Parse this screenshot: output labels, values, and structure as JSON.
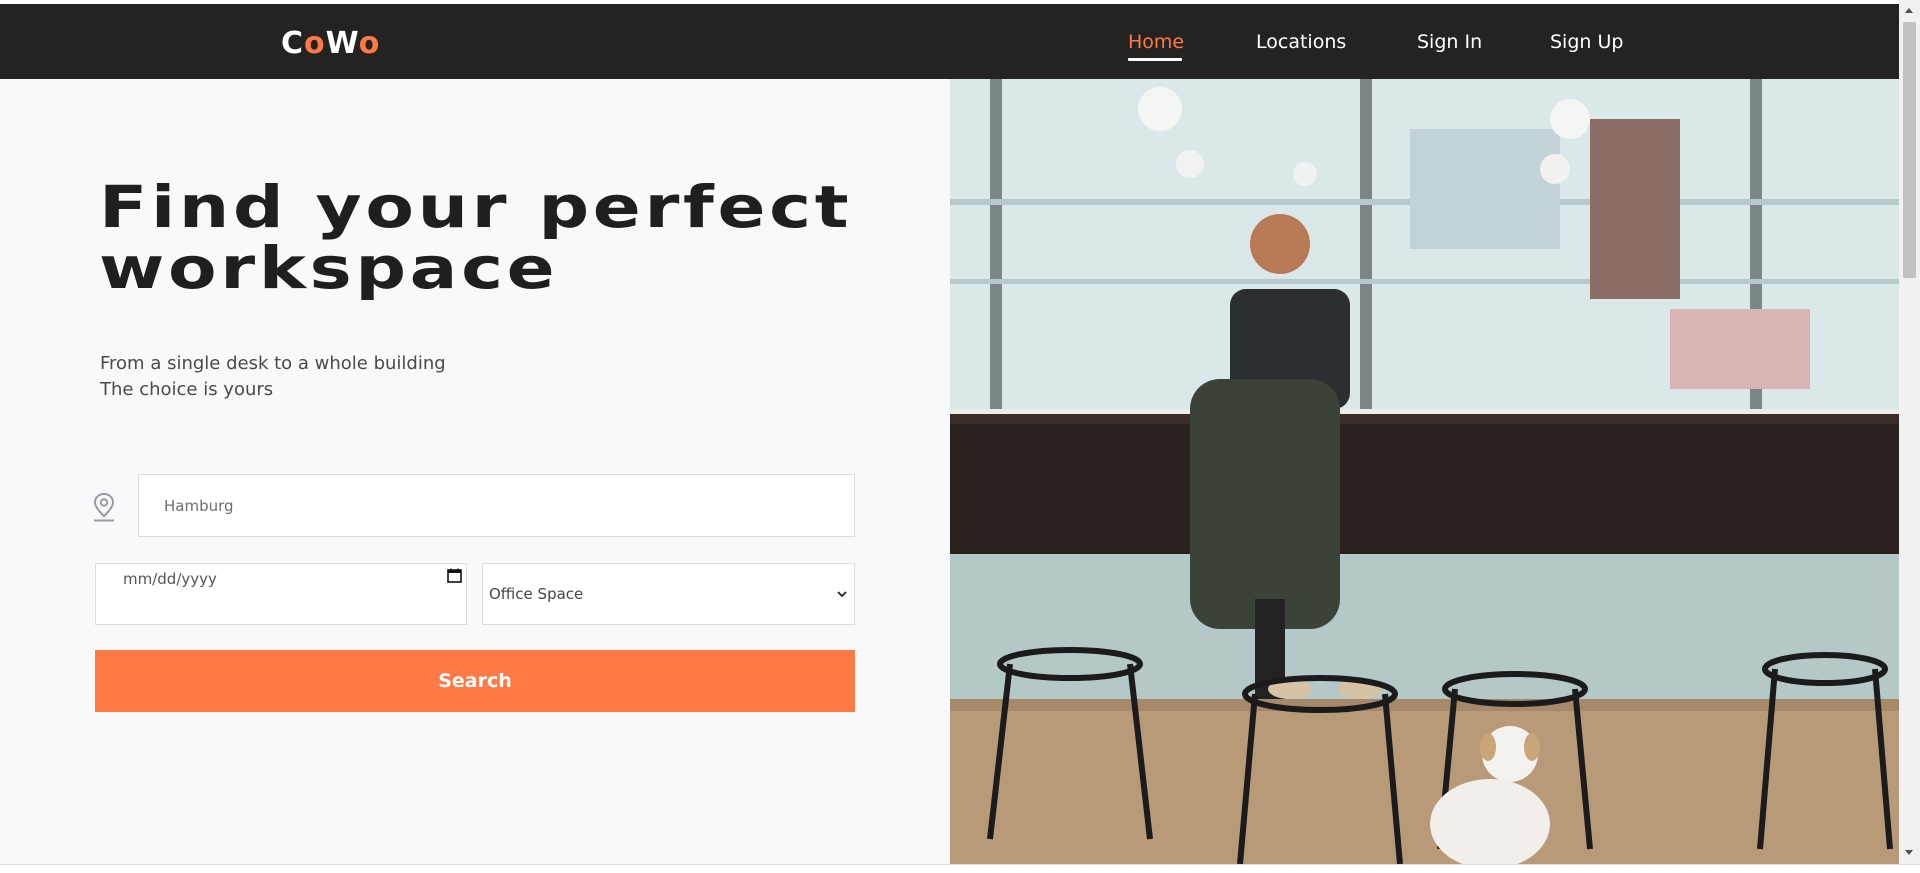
{
  "brand": {
    "logo_letters": [
      "C",
      "o",
      "W",
      "o"
    ],
    "accent_color": "#ff7a45",
    "nav_bg": "#252321"
  },
  "nav": {
    "items": [
      {
        "label": "Home",
        "active": true
      },
      {
        "label": "Locations",
        "active": false
      },
      {
        "label": "Sign In",
        "active": false
      },
      {
        "label": "Sign Up",
        "active": false
      }
    ]
  },
  "hero": {
    "title_line1": "Find your perfect",
    "title_line2": "workspace",
    "subtitle_line1": "From a single desk to a whole building",
    "subtitle_line2": "The choice is yours"
  },
  "search": {
    "location_value": "Hamburg",
    "date_placeholder": "mm/dd/yyyy",
    "space_type_selected": "Office Space",
    "button_label": "Search"
  },
  "icons": {
    "location": "map-pin-icon",
    "date": "calendar-icon",
    "select": "chevron-down-icon"
  }
}
